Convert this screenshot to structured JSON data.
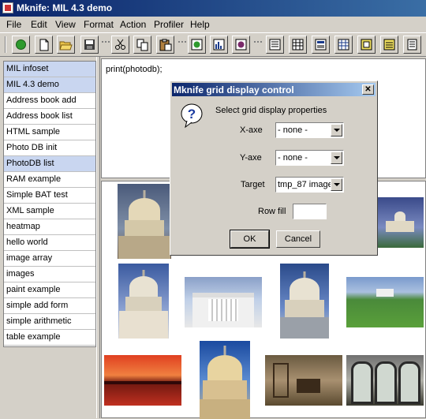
{
  "window": {
    "title": "Mknife: MIL 4.3 demo"
  },
  "menu": [
    "File",
    "Edit",
    "View",
    "Format",
    "Action",
    "Profiler",
    "Help"
  ],
  "toolbar": {
    "buttons": [
      "run-icon",
      "new-file-icon",
      "open-folder-icon",
      "save-icon",
      "cut-icon",
      "copy-icon",
      "paste-icon",
      "record-icon",
      "bar-chart-icon",
      "stop-icon",
      "list-view-icon",
      "table-view-icon",
      "form-view-icon",
      "grid-view-icon",
      "image-view-icon",
      "chart-view-icon",
      "document-view-icon"
    ]
  },
  "sidebar": {
    "items": [
      {
        "label": "MIL infoset",
        "selected": true
      },
      {
        "label": "MIL 4.3 demo",
        "selected": true
      },
      {
        "label": "Address book add",
        "selected": false
      },
      {
        "label": "Address book list",
        "selected": false
      },
      {
        "label": "HTML sample",
        "selected": false
      },
      {
        "label": "Photo DB init",
        "selected": false
      },
      {
        "label": "PhotoDB list",
        "selected": true
      },
      {
        "label": "RAM example",
        "selected": false
      },
      {
        "label": "Simple BAT test",
        "selected": false
      },
      {
        "label": "XML sample",
        "selected": false
      },
      {
        "label": "heatmap",
        "selected": false
      },
      {
        "label": "hello world",
        "selected": false
      },
      {
        "label": "image array",
        "selected": false
      },
      {
        "label": "images",
        "selected": false
      },
      {
        "label": "paint example",
        "selected": false
      },
      {
        "label": "simple add form",
        "selected": false
      },
      {
        "label": "simple arithmetic",
        "selected": false
      },
      {
        "label": "table example",
        "selected": false
      }
    ]
  },
  "script": {
    "text": "print(photodb);"
  },
  "dialog": {
    "title": "Mknife grid display control",
    "prompt": "Select grid display properties",
    "xaxis_label": "X-axe",
    "xaxis_value": "- none -",
    "yaxis_label": "Y-axe",
    "yaxis_value": "- none -",
    "target_label": "Target",
    "target_value": "tmp_87 image",
    "rowfill_label": "Row fill",
    "rowfill_value": "",
    "ok_label": "OK",
    "cancel_label": "Cancel",
    "icon": "question-icon"
  },
  "colors": {
    "title_bar": "#0a246a",
    "selection": "#c9d6f0",
    "dialog_bg": "#d4d0c8"
  }
}
